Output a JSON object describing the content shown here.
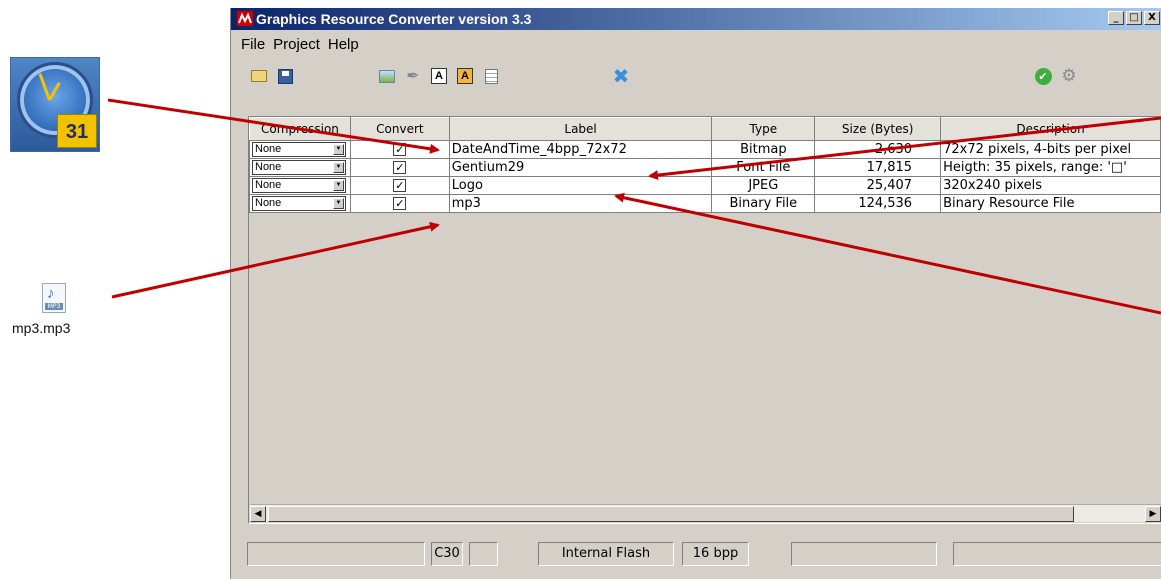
{
  "desktop": {
    "clock_calendar_day": "31",
    "mp3_icon_tag": "MP3",
    "mp3_file_label": "mp3.mp3"
  },
  "window": {
    "title": "Graphics Resource Converter version 3.3",
    "controls": {
      "minimize": "_",
      "maximize": "□",
      "close": "X"
    }
  },
  "menu": [
    "File",
    "Project",
    "Help"
  ],
  "toolbar": {
    "icons": [
      "open-folder-icon",
      "save-icon",
      "add-image-icon",
      "wand-icon",
      "add-font-icon",
      "add-font-table-icon",
      "add-binary-icon",
      "remove-icon",
      "check-icon",
      "settings-icon"
    ]
  },
  "grid": {
    "columns": [
      "Compression",
      "Convert",
      "Label",
      "Type",
      "Size (Bytes)",
      "Description"
    ],
    "rows": [
      {
        "compression": "None",
        "convert": "✓",
        "label": "DateAndTime_4bpp_72x72",
        "type": "Bitmap",
        "size": "2,630",
        "description": "72x72 pixels, 4-bits per pixel"
      },
      {
        "compression": "None",
        "convert": "✓",
        "label": "Gentium29",
        "type": "Font File",
        "size": "17,815",
        "description": "Heigth: 35 pixels, range: '□'"
      },
      {
        "compression": "None",
        "convert": "✓",
        "label": "Logo",
        "type": "JPEG",
        "size": "25,407",
        "description": "320x240 pixels"
      },
      {
        "compression": "None",
        "convert": "✓",
        "label": "mp3",
        "type": "Binary File",
        "size": "124,536",
        "description": "Binary Resource File"
      }
    ]
  },
  "statusbar": {
    "compiler": "C30",
    "memory": "Internal Flash",
    "bpp": "16 bpp"
  },
  "colors": {
    "title_start": "#0a246a",
    "title_end": "#a6caf0",
    "window_bg": "#d4d0c8",
    "arrow": "#c00000"
  }
}
